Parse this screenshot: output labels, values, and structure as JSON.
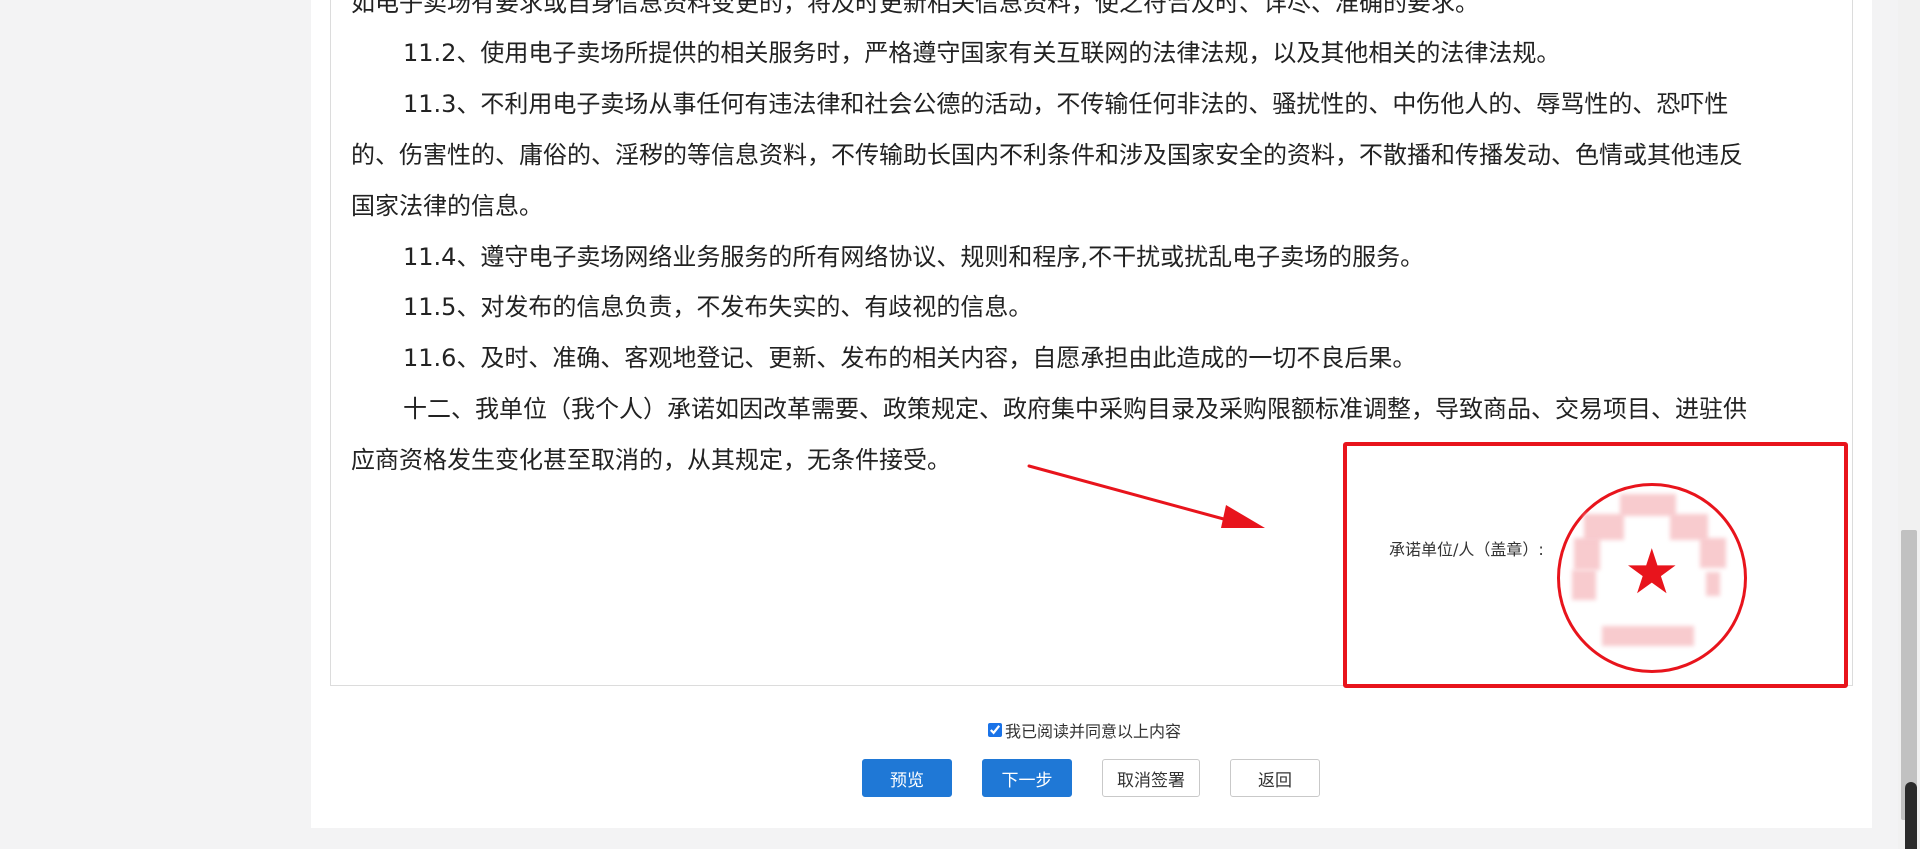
{
  "agreement": {
    "paragraphs": [
      "如电子卖场有要求或自身信息资料变更的，将及时更新相关信息资料，使之符合及时、详尽、准确的要求。",
      "11.2、使用电子卖场所提供的相关服务时，严格遵守国家有关互联网的法律法规，以及其他相关的法律法规。",
      "11.3、不利用电子卖场从事任何有违法律和社会公德的活动，不传输任何非法的、骚扰性的、中伤他人的、辱骂性的、恐吓性",
      "的、伤害性的、庸俗的、淫秽的等信息资料，不传输助长国内不利条件和涉及国家安全的资料，不散播和传播发动、色情或其他违反",
      "国家法律的信息。",
      "11.4、遵守电子卖场网络业务服务的所有网络协议、规则和程序,不干扰或扰乱电子卖场的服务。",
      "11.5、对发布的信息负责，不发布失实的、有歧视的信息。",
      "11.6、及时、准确、客观地登记、更新、发布的相关内容，自愿承担由此造成的一切不良后果。",
      "十二、我单位（我个人）承诺如因改革需要、政策规定、政府集中采购目录及采购限额标准调整，导致商品、交易项目、进驻供",
      "应商资格发生变化甚至取消的，从其规定，无条件接受。"
    ]
  },
  "signature": {
    "label": "承诺单位/人（盖章）:"
  },
  "agree": {
    "label": "我已阅读并同意以上内容",
    "checked": true
  },
  "buttons": {
    "preview": "预览",
    "next": "下一步",
    "cancel_sign": "取消签署",
    "back": "返回"
  },
  "colors": {
    "primary": "#1f78d6",
    "annotation_red": "#e8141c"
  }
}
